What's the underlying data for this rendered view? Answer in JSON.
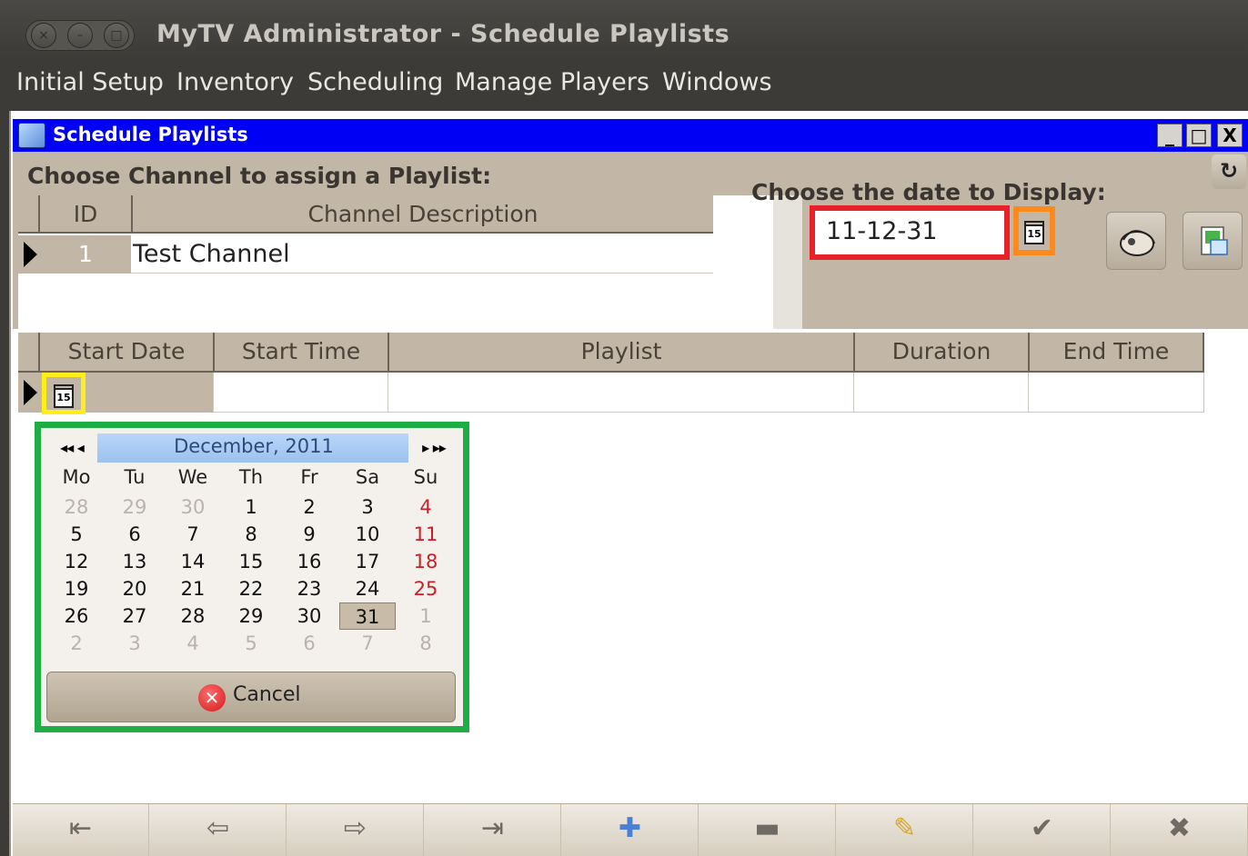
{
  "window": {
    "title": "MyTV Administrator - Schedule Playlists",
    "controls": [
      "×",
      "–",
      "□"
    ]
  },
  "menu": [
    "Initial Setup",
    "Inventory",
    "Scheduling",
    "Manage Players",
    "Windows"
  ],
  "internal_frame": {
    "title": "Schedule Playlists",
    "buttons": [
      "_",
      "□",
      "X"
    ]
  },
  "channel_section": {
    "heading": "Choose Channel to assign a Playlist:",
    "columns": [
      "ID",
      "Channel Description"
    ],
    "rows": [
      {
        "id": "1",
        "description": "Test Channel"
      }
    ]
  },
  "date_section": {
    "heading": "Choose the date to Display:",
    "value": "11-12-31",
    "calendar_icon_text": "15",
    "refresh_glyph": "↻"
  },
  "schedule_grid": {
    "columns": [
      "Start Date",
      "Start Time",
      "Playlist",
      "Duration",
      "End Time"
    ],
    "calendar_icon_text": "15"
  },
  "calendar": {
    "month_year": "December, 2011",
    "nav_prev": "◂◂ ◂",
    "nav_next": "▸ ▸▸",
    "weekdays": [
      "Mo",
      "Tu",
      "We",
      "Th",
      "Fr",
      "Sa",
      "Su"
    ],
    "weeks": [
      [
        "28",
        "29",
        "30",
        "1",
        "2",
        "3",
        "4"
      ],
      [
        "5",
        "6",
        "7",
        "8",
        "9",
        "10",
        "11"
      ],
      [
        "12",
        "13",
        "14",
        "15",
        "16",
        "17",
        "18"
      ],
      [
        "19",
        "20",
        "21",
        "22",
        "23",
        "24",
        "25"
      ],
      [
        "26",
        "27",
        "28",
        "29",
        "30",
        "31",
        "1"
      ],
      [
        "2",
        "3",
        "4",
        "5",
        "6",
        "7",
        "8"
      ]
    ],
    "selected_day": "31",
    "cancel_label": "Cancel",
    "colors": {
      "sunday": "#c8202a",
      "muted": "#b8b3ab"
    }
  },
  "navigation": [
    {
      "name": "first-record-icon",
      "glyph": "⇤"
    },
    {
      "name": "previous-record-icon",
      "glyph": "⇦"
    },
    {
      "name": "next-record-icon",
      "glyph": "⇨"
    },
    {
      "name": "last-record-icon",
      "glyph": "⇥"
    },
    {
      "name": "add-record-icon",
      "glyph": "✚"
    },
    {
      "name": "delete-record-icon",
      "glyph": "▬"
    },
    {
      "name": "edit-record-icon",
      "glyph": "✎"
    },
    {
      "name": "save-record-icon",
      "glyph": "✔"
    },
    {
      "name": "cancel-record-icon",
      "glyph": "✖"
    }
  ],
  "colors": {
    "titlebar": "#3c3b37",
    "internal_title": "#0000f5",
    "panel": "#c2b7a7",
    "date_highlight": "#e8202a",
    "calendar_button_highlight": "#ff8a1c",
    "start_date_highlight": "#ffee1a",
    "calendar_highlight": "#1fae45"
  }
}
